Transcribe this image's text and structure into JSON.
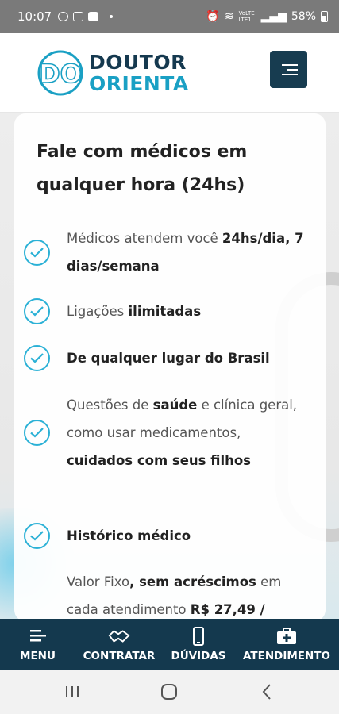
{
  "status_bar": {
    "time": "10:07",
    "battery": "58%",
    "network": "VoLTE LTE1"
  },
  "header": {
    "logo_line1": "DOUTOR",
    "logo_line2": "ORIENTA",
    "logo_mark": "DO"
  },
  "card": {
    "title": "Fale com médicos em qualquer hora (24hs)",
    "features": [
      {
        "normal1": "Médicos atendem você ",
        "bold1": "24hs/dia, 7 dias/semana",
        "normal2": "",
        "bold2": ""
      },
      {
        "normal1": "Ligações ",
        "bold1": "ilimitadas",
        "normal2": "",
        "bold2": ""
      },
      {
        "normal1": "",
        "bold1": "De qualquer lugar do Brasil",
        "normal2": "",
        "bold2": ""
      },
      {
        "normal1": "Questões de ",
        "bold1": "saúde",
        "normal2": " e clínica geral, como usar medicamentos, ",
        "bold2": "cuidados com seus filhos"
      },
      {
        "normal1": "",
        "bold1": "Histórico médico",
        "normal2": "",
        "bold2": ""
      },
      {
        "normal1": "Valor Fixo",
        "bold1": ", sem acréscimos",
        "normal2": " em cada atendimento ",
        "bold2": "R$ 27,49 /"
      }
    ]
  },
  "bottom_nav": {
    "items": [
      {
        "label": "MENU",
        "icon": "menu-lines-icon"
      },
      {
        "label": "CONTRATAR",
        "icon": "handshake-icon"
      },
      {
        "label": "DÚVIDAS",
        "icon": "phone-icon"
      },
      {
        "label": "ATENDIMENTO",
        "icon": "medical-kit-icon"
      }
    ]
  },
  "colors": {
    "brand_dark": "#14394e",
    "brand_light": "#1aa0c4",
    "check": "#2bb1d6"
  }
}
